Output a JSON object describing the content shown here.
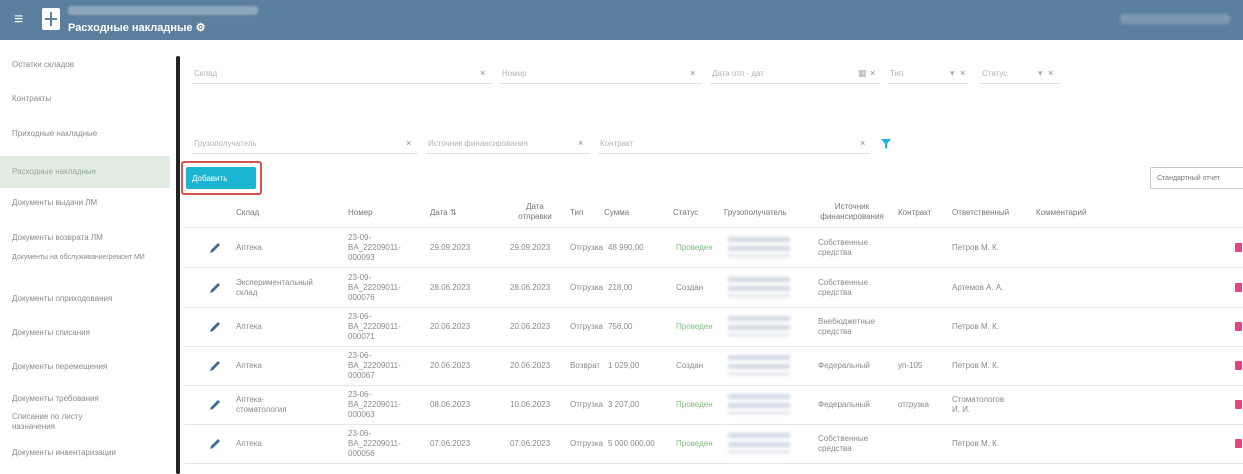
{
  "header": {
    "title": "Расходные накладные",
    "page_icon": "settings-gear-icon",
    "org_name_blurred": true,
    "user_blurred": true,
    "bar_color": "#5b7f9e"
  },
  "sidebar": {
    "items": [
      {
        "label": "Остатки складов"
      },
      {
        "label": "Контракты"
      },
      {
        "label": "Приходные накладные"
      },
      {
        "label": "Расходные накладные",
        "active": true
      },
      {
        "label": "Документы выдачи ЛМ"
      },
      {
        "label": "Документы возврата ЛМ"
      },
      {
        "label": "Документы на обслуживание/ремонт МИ"
      },
      {
        "label": "Документы оприходования"
      },
      {
        "label": "Документы списания"
      },
      {
        "label": "Документы перемещения"
      },
      {
        "label": "Документы требования"
      },
      {
        "label": "Списание по листу назначения"
      },
      {
        "label": "Документы инвентаризации"
      }
    ]
  },
  "filters": {
    "sklad": "Склад",
    "nomer": "Номер",
    "data": "Дата отп - дат",
    "tip": "Тип",
    "status": "Статус",
    "gruzopoluchatel": "Грузополучатель",
    "istochnik": "Источник финансирования",
    "kontrakt": "Контракт"
  },
  "toolbar": {
    "add_label": "Добавить",
    "report_label": "Стандартный отчет",
    "accent_color": "#1cb6d2",
    "highlight_color": "#d9534f"
  },
  "table": {
    "columns": {
      "sklad": "Склад",
      "nomer": "Номер",
      "data": "Дата",
      "data_otpravki": "Дата отправки",
      "tip": "Тип",
      "summa": "Сумма",
      "status": "Статус",
      "gruzopoluchatel": "Грузополучатель",
      "istochnik": "Источник финансирования",
      "kontrakt": "Контракт",
      "otvetstvennyy": "Ответственный",
      "kommentariy": "Комментарий"
    },
    "rows": [
      {
        "sklad": "Аптека",
        "nomer": "23-09-BA_22209011-000093",
        "data": "29.09.2023",
        "data_otpravki": "29.09.2023",
        "tip": "Отгрузка",
        "summa": "48 990,00",
        "status": "Проведен",
        "istochnik": "Собственные средства",
        "kontrakt": "",
        "otvetstvennyy": "Петров М. К.",
        "kommentariy": ""
      },
      {
        "sklad": "Экспериментальный склад",
        "nomer": "23-09-BA_22209011-000076",
        "data": "28.06.2023",
        "data_otpravki": "28.06.2023",
        "tip": "Отгрузка",
        "summa": "218,00",
        "status": "Создан",
        "istochnik": "Собственные средства",
        "kontrakt": "",
        "otvetstvennyy": "Артемов А. А.",
        "kommentariy": ""
      },
      {
        "sklad": "Аптека",
        "nomer": "23-06-BA_22209011-000071",
        "data": "20.06.2023",
        "data_otpravki": "20.06.2023",
        "tip": "Отгрузка",
        "summa": "756,00",
        "status": "Проведен",
        "istochnik": "Внебюджетные средства",
        "kontrakt": "",
        "otvetstvennyy": "Петров М. К.",
        "kommentariy": ""
      },
      {
        "sklad": "Аптека",
        "nomer": "23-06-BA_22209011-000067",
        "data": "20.06.2023",
        "data_otpravki": "20.06.2023",
        "tip": "Возврат",
        "summa": "1 029,00",
        "status": "Создан",
        "istochnik": "Федеральный",
        "kontrakt": "уп-105",
        "otvetstvennyy": "Петров М. К.",
        "kommentariy": ""
      },
      {
        "sklad": "Аптека-стоматология",
        "nomer": "23-06-BA_22209011-000063",
        "data": "08.06.2023",
        "data_otpravki": "10.06.2023",
        "tip": "Отгрузка",
        "summa": "3 207,00",
        "status": "Проведен",
        "istochnik": "Федеральный",
        "kontrakt": "отгрузка",
        "otvetstvennyy": "Стоматологов И. И.",
        "kommentariy": ""
      },
      {
        "sklad": "Аптека",
        "nomer": "23-06-BA_22209011-000056",
        "data": "07.06.2023",
        "data_otpravki": "07.06.2023",
        "tip": "Отгрузка",
        "summa": "5 000 000,00",
        "status": "Проведен",
        "istochnik": "Собственные средства",
        "kontrakt": "",
        "otvetstvennyy": "Петров М. К.",
        "kommentariy": ""
      }
    ]
  }
}
